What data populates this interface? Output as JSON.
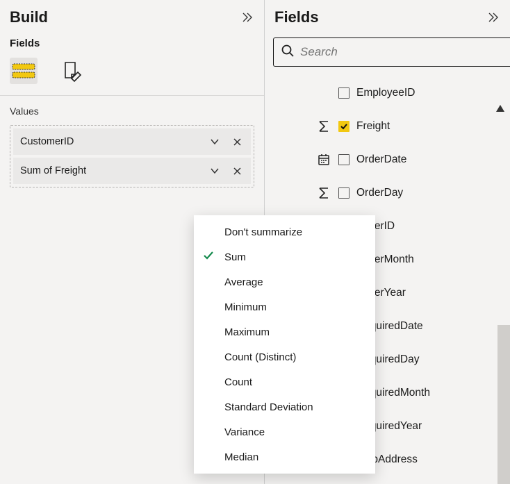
{
  "leftPane": {
    "title": "Build",
    "subTitle": "Fields",
    "sectionLabel": "Values",
    "valuePills": [
      {
        "label": "CustomerID"
      },
      {
        "label": "Sum of Freight"
      }
    ]
  },
  "rightPane": {
    "title": "Fields",
    "searchPlaceholder": "Search",
    "fields": [
      {
        "label": "EmployeeID",
        "checked": false,
        "icon": ""
      },
      {
        "label": "Freight",
        "checked": true,
        "icon": "sigma"
      },
      {
        "label": "OrderDate",
        "checked": false,
        "icon": "calendar"
      },
      {
        "label": "OrderDay",
        "checked": false,
        "icon": "sigma"
      },
      {
        "label": "OrderID",
        "checked": false,
        "icon": ""
      },
      {
        "label": "OrderMonth",
        "checked": false,
        "icon": ""
      },
      {
        "label": "OrderYear",
        "checked": false,
        "icon": ""
      },
      {
        "label": "RequiredDate",
        "checked": false,
        "icon": ""
      },
      {
        "label": "RequiredDay",
        "checked": false,
        "icon": ""
      },
      {
        "label": "RequiredMonth",
        "checked": false,
        "icon": ""
      },
      {
        "label": "RequiredYear",
        "checked": false,
        "icon": ""
      },
      {
        "label": "ShipAddress",
        "checked": false,
        "icon": ""
      }
    ]
  },
  "contextMenu": {
    "items": [
      {
        "label": "Don't summarize",
        "selected": false
      },
      {
        "label": "Sum",
        "selected": true
      },
      {
        "label": "Average",
        "selected": false
      },
      {
        "label": "Minimum",
        "selected": false
      },
      {
        "label": "Maximum",
        "selected": false
      },
      {
        "label": "Count (Distinct)",
        "selected": false
      },
      {
        "label": "Count",
        "selected": false
      },
      {
        "label": "Standard Deviation",
        "selected": false
      },
      {
        "label": "Variance",
        "selected": false
      },
      {
        "label": "Median",
        "selected": false
      }
    ]
  }
}
